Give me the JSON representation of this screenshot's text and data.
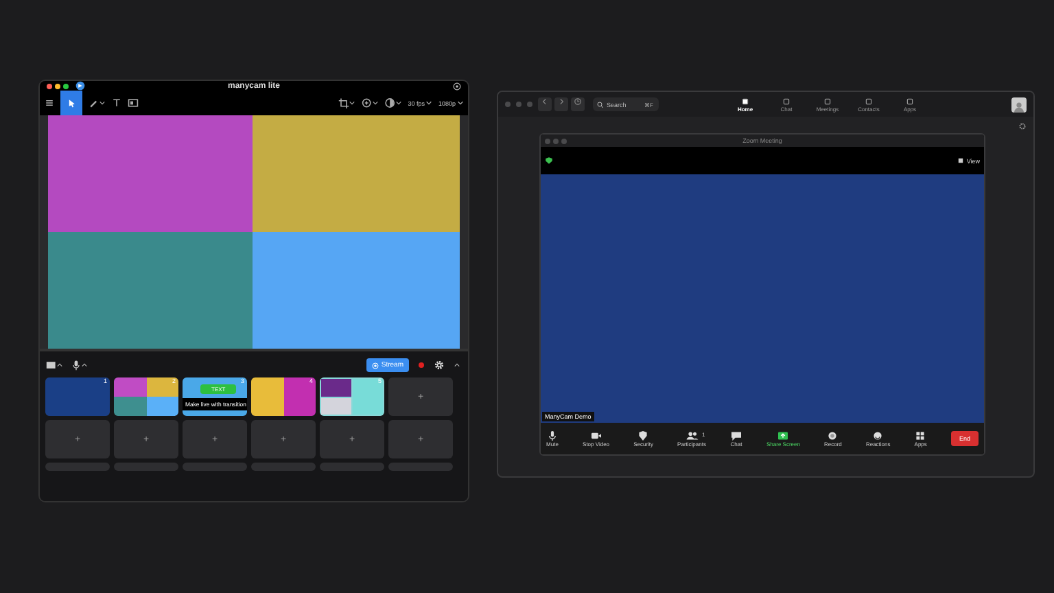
{
  "manycam": {
    "title": "manycam lite",
    "toolbar_right": [
      {
        "kind": "crop"
      },
      {
        "kind": "zoom"
      },
      {
        "kind": "fx"
      },
      {
        "kind": "text",
        "label": "30 fps"
      },
      {
        "kind": "text",
        "label": "1080p"
      }
    ],
    "stream_button": "Stream",
    "presets": [
      {
        "number": "1",
        "kind": "solid"
      },
      {
        "number": "2",
        "kind": "quad"
      },
      {
        "number": "3",
        "kind": "text",
        "badge": "TEXT",
        "tooltip": "Make live with transition"
      },
      {
        "number": "4",
        "kind": "halves"
      },
      {
        "number": "5",
        "kind": "tiles"
      },
      {
        "kind": "empty",
        "label": "+"
      },
      {
        "kind": "empty",
        "label": "+"
      },
      {
        "kind": "empty",
        "label": "+"
      },
      {
        "kind": "empty",
        "label": "+"
      },
      {
        "kind": "empty",
        "label": "+"
      },
      {
        "kind": "empty",
        "label": "+"
      },
      {
        "kind": "empty",
        "label": "+"
      }
    ]
  },
  "zoom": {
    "search": {
      "placeholder": "Search",
      "shortcut": "⌘F"
    },
    "tabs": [
      {
        "label": "Home",
        "selected": true
      },
      {
        "label": "Chat",
        "selected": false
      },
      {
        "label": "Meetings",
        "selected": false
      },
      {
        "label": "Contacts",
        "selected": false
      },
      {
        "label": "Apps",
        "selected": false
      }
    ],
    "meeting": {
      "title": "Zoom Meeting",
      "view": "View",
      "participant_name": "ManyCam Demo",
      "controls": [
        {
          "kind": "mic",
          "label": "Mute"
        },
        {
          "kind": "video",
          "label": "Stop Video"
        },
        {
          "kind": "shield",
          "label": "Security"
        },
        {
          "kind": "people",
          "label": "Participants",
          "count": "1"
        },
        {
          "kind": "chat",
          "label": "Chat"
        },
        {
          "kind": "share",
          "label": "Share Screen"
        },
        {
          "kind": "record",
          "label": "Record"
        },
        {
          "kind": "smile",
          "label": "Reactions"
        },
        {
          "kind": "apps",
          "label": "Apps"
        }
      ],
      "end": "End"
    }
  }
}
